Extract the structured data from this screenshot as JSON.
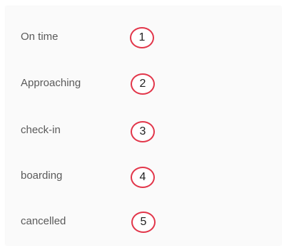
{
  "statuses": [
    {
      "label": "On time",
      "number": "1"
    },
    {
      "label": "Approaching",
      "number": "2"
    },
    {
      "label": "check-in",
      "number": "3"
    },
    {
      "label": "boarding",
      "number": "4"
    },
    {
      "label": "cancelled",
      "number": "5"
    }
  ],
  "colors": {
    "badge_border": "#e2364a",
    "label_text": "#5a5a5a",
    "panel_bg": "#fafafa"
  }
}
